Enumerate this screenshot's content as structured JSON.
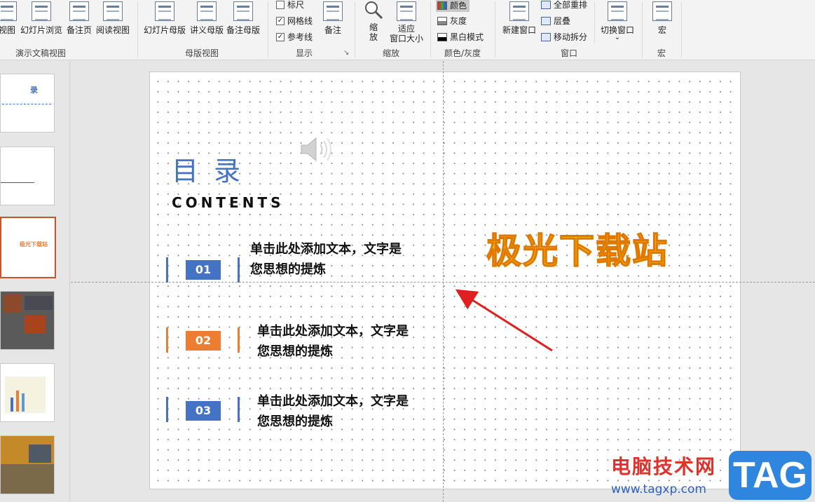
{
  "ribbon": {
    "groups": [
      {
        "label": "演示文稿视图",
        "buttons": [
          "视图",
          "幻灯片浏览",
          "备注页",
          "阅读视图"
        ]
      },
      {
        "label": "母版视图",
        "buttons": [
          "幻灯片母版",
          "讲义母版",
          "备注母版"
        ]
      },
      {
        "label": "显示",
        "checkboxes": [
          {
            "label": "标尺",
            "checked": false
          },
          {
            "label": "网格线",
            "checked": true
          },
          {
            "label": "参考线",
            "checked": true
          }
        ],
        "buttons": [
          "备注"
        ]
      },
      {
        "label": "缩放",
        "buttons": [
          "缩放",
          "适应窗口大小"
        ]
      },
      {
        "label": "颜色/灰度",
        "items": [
          "颜色",
          "灰度",
          "黑白模式"
        ]
      },
      {
        "label": "窗口",
        "buttons": [
          "新建窗口"
        ],
        "items": [
          "全部重排",
          "层叠",
          "移动拆分"
        ],
        "switch": "切换窗口"
      },
      {
        "label": "宏",
        "buttons": [
          "宏"
        ]
      }
    ],
    "zoom_btn_line1": "缩",
    "zoom_btn_line2": "放",
    "fit_btn_line1": "适应",
    "fit_btn_line2": "窗口大小",
    "check_mark": "✓",
    "dropdown_caret": "⌄",
    "launcher_icon": "↘"
  },
  "slide": {
    "title_cn": "目录",
    "title_en": "CONTENTS",
    "items": [
      {
        "num": "01",
        "line1": "单击此处添加文本，文字是",
        "line2": "您思想的提炼",
        "color": "#4472c4"
      },
      {
        "num": "02",
        "line1": "单击此处添加文本，文字是",
        "line2": "您思想的提炼",
        "color": "#ed7d31"
      },
      {
        "num": "03",
        "line1": "单击此处添加文本，文字是",
        "line2": "您思想的提炼",
        "color": "#4472c4"
      }
    ],
    "wordart": "极光下载站"
  },
  "thumbnails": {
    "slide1_title": "录",
    "slide3_title": "极光下载站"
  },
  "watermark": {
    "site_cn": "电脑技术网",
    "url": "www.tagxp.com",
    "tag": "TAG"
  }
}
